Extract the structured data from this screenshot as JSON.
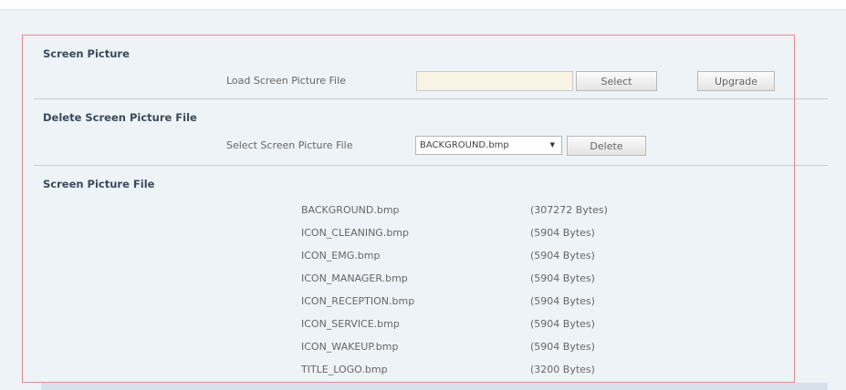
{
  "screen_picture": {
    "title": "Screen Picture",
    "load_label": "Load Screen Picture File",
    "file_value": "",
    "select_button": "Select",
    "upgrade_button": "Upgrade"
  },
  "delete_section": {
    "title": "Delete Screen Picture File",
    "select_label": "Select Screen Picture File",
    "selected_file": "BACKGROUND.bmp",
    "delete_button": "Delete"
  },
  "file_section": {
    "title": "Screen Picture File",
    "files": [
      {
        "name": "BACKGROUND.bmp",
        "size": "(307272 Bytes)"
      },
      {
        "name": "ICON_CLEANING.bmp",
        "size": "(5904 Bytes)"
      },
      {
        "name": "ICON_EMG.bmp",
        "size": "(5904 Bytes)"
      },
      {
        "name": "ICON_MANAGER.bmp",
        "size": "(5904 Bytes)"
      },
      {
        "name": "ICON_RECEPTION.bmp",
        "size": "(5904 Bytes)"
      },
      {
        "name": "ICON_SERVICE.bmp",
        "size": "(5904 Bytes)"
      },
      {
        "name": "ICON_WAKEUP.bmp",
        "size": "(5904 Bytes)"
      },
      {
        "name": "TITLE_LOGO.bmp",
        "size": "(3200 Bytes)"
      }
    ]
  }
}
